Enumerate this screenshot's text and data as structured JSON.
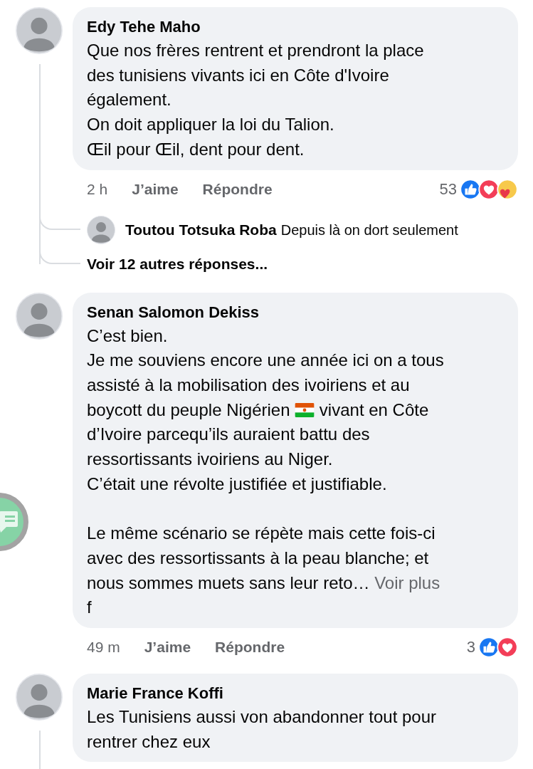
{
  "comments": [
    {
      "author": "Edy Tehe Maho",
      "body": [
        {
          "kind": "text",
          "text": "Que nos frères rentrent et prendront la place\ndes tunisiens vivants ici en Côte d'Ivoire\négalement.\nOn doit appliquer la loi du Talion.\nŒil pour Œil, dent pour dent."
        }
      ],
      "thread_line": true,
      "meta": {
        "time": "2 h",
        "like": "J’aime",
        "reply": "Répondre",
        "reaction_count": "53",
        "reactions": [
          {
            "kind": "like"
          },
          {
            "kind": "love"
          },
          {
            "kind": "care"
          }
        ]
      },
      "replies": [
        {
          "author": "Toutou Totsuka Roba",
          "text": "Depuis là on dort seulement"
        }
      ],
      "more_replies": "Voir 12 autres réponses..."
    },
    {
      "author": "Senan Salomon Dekiss",
      "body": [
        {
          "kind": "text",
          "text": "C’est bien.\nJe me souviens encore une année ici on a tous\nassisté à la mobilisation des ivoiriens et au\nboycott du peuple Nigérien "
        },
        {
          "kind": "flag"
        },
        {
          "kind": "text",
          "text": " vivant en Côte\nd’Ivoire parcequ’ils auraient battu des\nressortissants ivoiriens au Niger.\nC’était une révolte justifiée et justifiable.\n\nLe même scénario se répète mais cette fois-ci\navec des ressortissants à la peau blanche; et\nnous sommes muets sans leur reto… "
        },
        {
          "kind": "link",
          "text": "Voir plus"
        },
        {
          "kind": "text",
          "text": "\nf"
        }
      ],
      "thread_line": false,
      "meta": {
        "time": "49 m",
        "like": "J’aime",
        "reply": "Répondre",
        "reaction_count": "3",
        "reactions": [
          {
            "kind": "like"
          },
          {
            "kind": "love"
          }
        ]
      }
    },
    {
      "author": "Marie France Koffi",
      "body": [
        {
          "kind": "text",
          "text": "Les Tunisiens aussi von abandonner tout pour\nrentrer chez eux"
        }
      ],
      "thread_line": true
    }
  ]
}
